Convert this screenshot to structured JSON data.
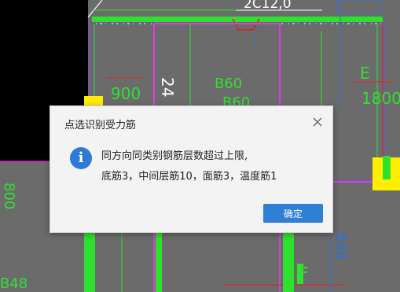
{
  "background": {
    "canvas_color": "#6b6b6b",
    "labels": {
      "top_rebar": "2C12,0",
      "dim_900": "900",
      "dim_24": "24",
      "b60": "B60",
      "b60_b": "B60",
      "e_mark": "E",
      "dim_1800": "1800",
      "left_800": "800",
      "b48": "B48",
      "f_mark": "F",
      "right_b48": "B48"
    }
  },
  "dialog": {
    "title": "点选识别受力筋",
    "message_line1": "同方向同类别钢筋层数超过上限,",
    "message_line2": "底筋3，中间层筋10，面筋3，温度筋1",
    "ok_label": "确定",
    "info_symbol": "i",
    "accent_color": "#2f7fd6"
  }
}
